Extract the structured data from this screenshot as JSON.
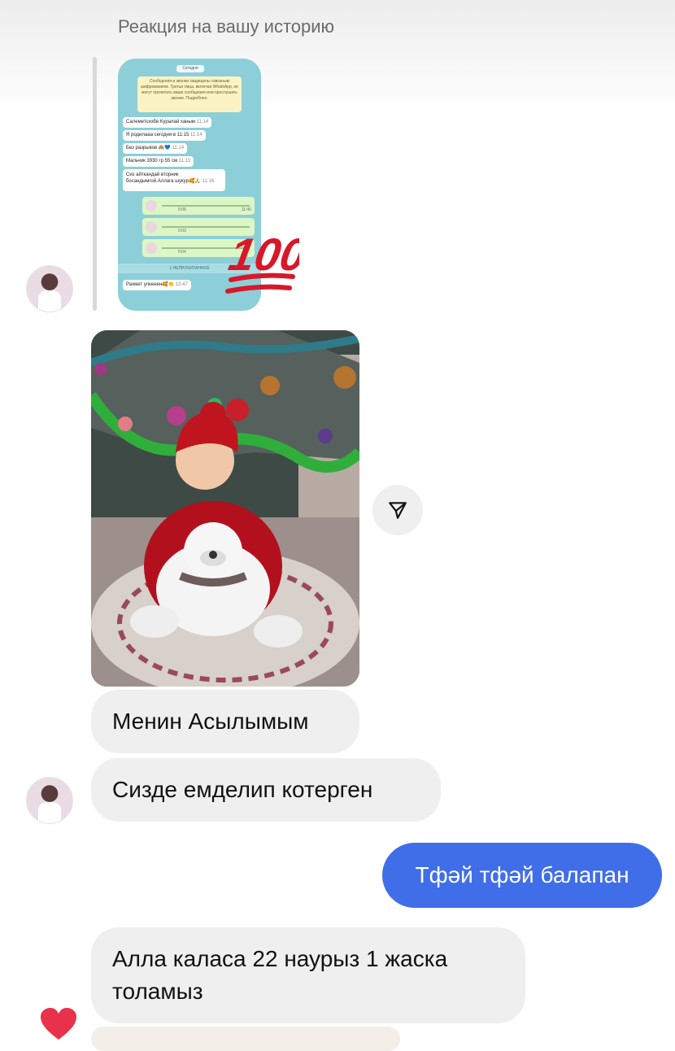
{
  "chat": {
    "story_reaction_header": "Реакция на вашу историю",
    "story_reaction_emoji": "100",
    "story_thumbnail": {
      "date_label": "Сегодня",
      "notice": "Сообщения и звонки защищены сквозным шифрованием. Третьи лица, включая WhatsApp, не могут прочитать ваши сообщения или прослушать звонки. Подробнее.",
      "messages": [
        {
          "text": "Салеметсизбе Куралай ханым",
          "time": "11:14"
        },
        {
          "text": "Я родилааа сегодня в 11:15",
          "time": "11:14"
        },
        {
          "text": "Без разрывов 🙈💙",
          "time": "11:14"
        },
        {
          "text": "Мальчик 3930 гр 55 см",
          "time": "11:15"
        },
        {
          "text": "Сиз айткандай вторник босандымгой.Аллага шукур🥰🙏",
          "time": "11:16"
        }
      ],
      "audio_times": [
        "0:06",
        "0:03",
        "0:04"
      ],
      "audio_stamp": "11:46",
      "unread_label": "1 НЕПРОЧИТАННОЕ",
      "last_message": {
        "text": "Рахмет улкееен🥰👏",
        "time": "13:47"
      }
    },
    "messages_in": [
      "Менин Асылымым",
      "Сизде емделип котерген",
      "Алла каласа 22 наурыз 1 жаска толамыз"
    ],
    "messages_out": [
      "Тфәй тфәй балапан"
    ]
  },
  "colors": {
    "outgoing_bubble": "#3f6ee8",
    "incoming_bubble": "#efefef",
    "reaction_heart": "#e8314a",
    "emoji_red": "#d8182a"
  }
}
